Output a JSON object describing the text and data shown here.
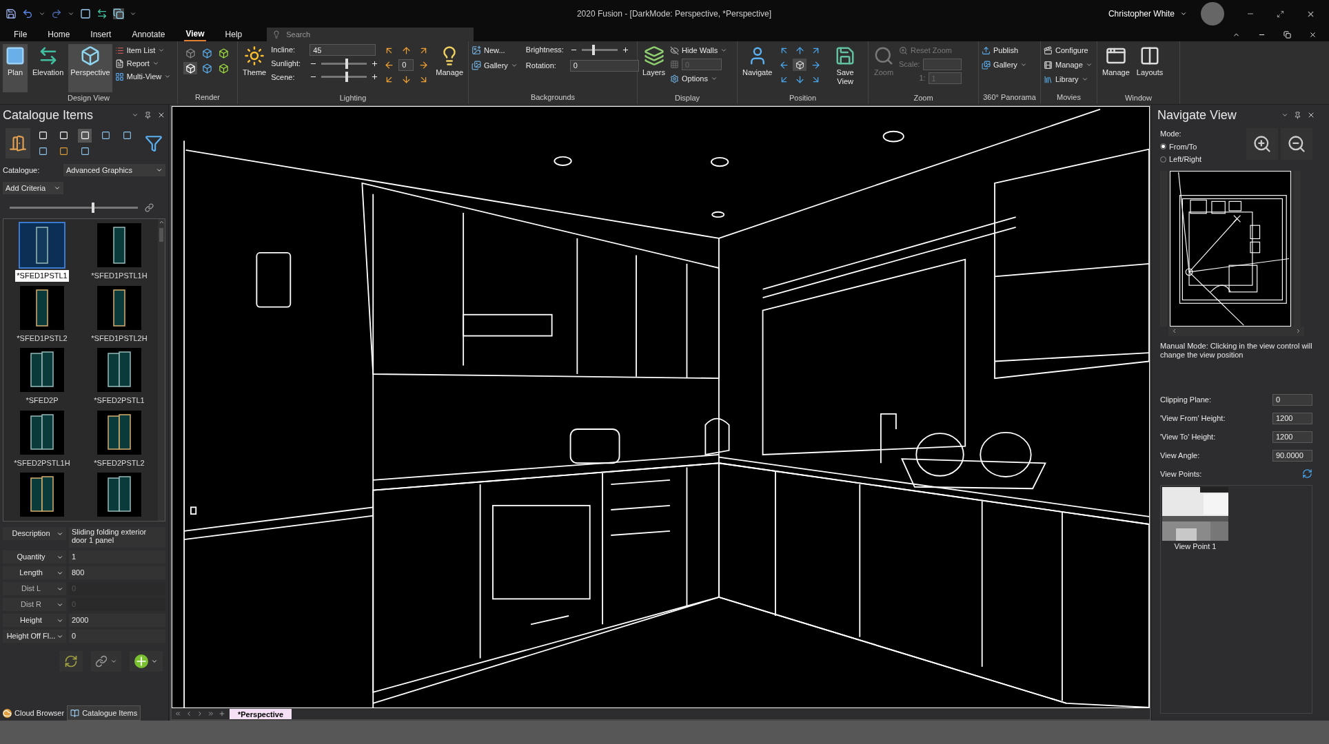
{
  "title_bar": {
    "title": "2020 Fusion - [DarkMode: Perspective, *Perspective]",
    "user": "Christopher White"
  },
  "menu_tabs": [
    {
      "label": "File",
      "selected": false
    },
    {
      "label": "Home",
      "selected": false
    },
    {
      "label": "Insert",
      "selected": false
    },
    {
      "label": "Annotate",
      "selected": false
    },
    {
      "label": "View",
      "selected": true
    },
    {
      "label": "Help",
      "selected": false
    }
  ],
  "search": {
    "placeholder": "Search"
  },
  "ribbon": {
    "design_view": {
      "label": "Design View",
      "large": [
        {
          "label": "Plan",
          "selected": true
        },
        {
          "label": "Elevation",
          "selected": false
        },
        {
          "label": "Perspective",
          "selected": true
        }
      ],
      "small": [
        "Item List",
        "Report",
        "Multi-View"
      ]
    },
    "render": {
      "label": "Render"
    },
    "lighting": {
      "label": "Lighting",
      "theme": "Theme",
      "incline": {
        "label": "Incline:",
        "value": "45"
      },
      "sunlight": {
        "label": "Sunlight:",
        "level": 0.55
      },
      "scene": {
        "label": "Scene:",
        "level": 0.55
      },
      "direction_value": "0",
      "manage": "Manage"
    },
    "backgrounds": {
      "label": "Backgrounds",
      "new": "New...",
      "gallery": "Gallery",
      "brightness": {
        "label": "Brightness:",
        "level": 0.35
      },
      "rotation": {
        "label": "Rotation:",
        "value": "0"
      }
    },
    "display": {
      "label": "Display",
      "layers": "Layers",
      "hide_walls": "Hide Walls",
      "grid_value": "0",
      "options": "Options"
    },
    "position": {
      "label": "Position",
      "navigate": "Navigate",
      "save_view": "Save View"
    },
    "zoom": {
      "label": "Zoom",
      "zoom": {
        "label": "Zoom",
        "disabled": true
      },
      "reset_zoom": {
        "label": "Reset Zoom",
        "disabled": true
      },
      "scale_label": "Scale:",
      "ratio_label": "1:",
      "ratio_value": "1"
    },
    "panorama": {
      "label": "360° Panorama",
      "publish": "Publish",
      "gallery": "Gallery"
    },
    "movies": {
      "label": "Movies",
      "configure": "Configure",
      "manage": "Manage",
      "library": "Library"
    },
    "window": {
      "label": "Window",
      "manage": "Manage",
      "layouts": "Layouts"
    }
  },
  "catalogue_panel": {
    "title": "Catalogue Items",
    "catalogue_label": "Catalogue:",
    "catalogue_value": "Advanced Graphics",
    "add_criteria": "Add Criteria",
    "size_slider": {
      "level": 0.65
    },
    "items": [
      {
        "label": "*SFED1PSTL1",
        "selected": true
      },
      {
        "label": "*SFED1PSTL1H",
        "selected": false
      },
      {
        "label": "*SFED1PSTL2",
        "selected": false
      },
      {
        "label": "*SFED1PSTL2H",
        "selected": false
      },
      {
        "label": "*SFED2P",
        "selected": false
      },
      {
        "label": "*SFED2PSTL1",
        "selected": false
      },
      {
        "label": "*SFED2PSTL1H",
        "selected": false
      },
      {
        "label": "*SFED2PSTL2",
        "selected": false
      },
      {
        "selected": false
      },
      {
        "selected": false
      }
    ],
    "properties": [
      {
        "label": "Description",
        "value": "Sliding folding exterior door 1 panel",
        "disabled": false
      },
      {
        "label": "Quantity",
        "value": "1",
        "disabled": false
      },
      {
        "label": "Length",
        "value": "800",
        "disabled": false
      },
      {
        "label": "Dist L",
        "value": "0",
        "disabled": true
      },
      {
        "label": "Dist R",
        "value": "0",
        "disabled": true
      },
      {
        "label": "Height",
        "value": "2000",
        "disabled": false
      },
      {
        "label": "Height Off Fl...",
        "value": "0",
        "disabled": false
      }
    ],
    "tabs": [
      {
        "label": "Cloud Browser",
        "selected": false
      },
      {
        "label": "Catalogue Items",
        "selected": true
      }
    ]
  },
  "document_tabs": [
    {
      "label": "*Perspective",
      "selected": true
    }
  ],
  "navigate_panel": {
    "title": "Navigate View",
    "mode_label": "Mode:",
    "modes": [
      {
        "label": "From/To",
        "selected": true
      },
      {
        "label": "Left/Right",
        "selected": false
      }
    ],
    "note": "Manual Mode: Clicking in the view control will change the view position",
    "fields": [
      {
        "label": "Clipping Plane:",
        "value": "0"
      },
      {
        "label": "'View From' Height:",
        "value": "1200"
      },
      {
        "label": "'View To' Height:",
        "value": "1200"
      },
      {
        "label": "View Angle:",
        "value": "90.0000"
      }
    ],
    "view_points_label": "View Points:",
    "view_points": [
      {
        "label": "View Point 1"
      }
    ]
  }
}
